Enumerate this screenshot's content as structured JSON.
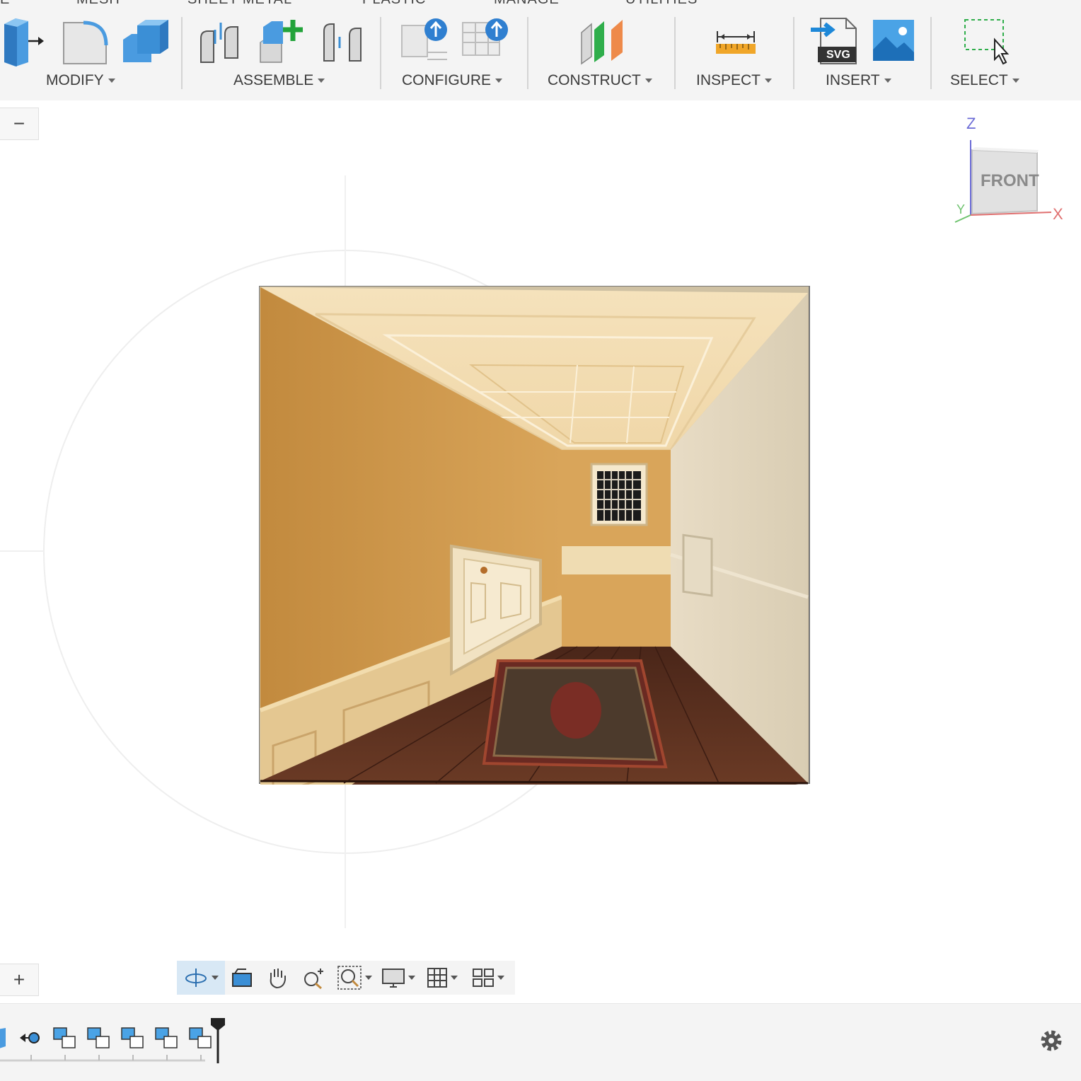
{
  "toolbar": {
    "tabs": [
      "E",
      "MESH",
      "SHEET METAL",
      "PLASTIC",
      "MANAGE",
      "UTILITIES"
    ],
    "groups": [
      {
        "label": "MODIFY"
      },
      {
        "label": "ASSEMBLE"
      },
      {
        "label": "CONFIGURE"
      },
      {
        "label": "CONSTRUCT"
      },
      {
        "label": "INSPECT"
      },
      {
        "label": "INSERT"
      },
      {
        "label": "SELECT"
      }
    ],
    "insert_svg_badge": "SVG"
  },
  "viewport": {
    "collapse_button": "−",
    "expand_button": "+",
    "model_name": "hallway render"
  },
  "viewcube": {
    "face": "FRONT",
    "axis_z": "Z",
    "axis_x": "X",
    "axis_y": "Y"
  },
  "colors": {
    "accent_blue": "#3b8fd6",
    "wall": "#c8954a",
    "floor": "#5b3222",
    "ceiling": "#f3ddb3"
  }
}
